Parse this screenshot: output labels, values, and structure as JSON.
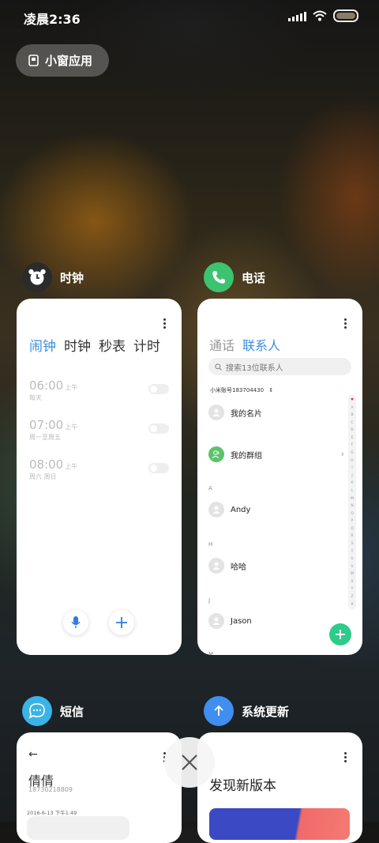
{
  "status_bar": {
    "time": "凌晨2:36"
  },
  "floating_window": {
    "label": "小窗应用"
  },
  "apps": {
    "clock": {
      "name": "时钟",
      "icon_color": "#2b2b2b",
      "tabs": [
        "闹钟",
        "时钟",
        "秒表",
        "计时"
      ],
      "alarms": [
        {
          "time": "06:00",
          "ampm": "上午",
          "repeat": "每天"
        },
        {
          "time": "07:00",
          "ampm": "上午",
          "repeat": "周一至周五"
        },
        {
          "time": "08:00",
          "ampm": "上午",
          "repeat": "周六 周日"
        }
      ]
    },
    "phone": {
      "name": "电话",
      "icon_color": "#3cc371",
      "tabs": [
        "通话",
        "联系人"
      ],
      "search_placeholder": "搜索13位联系人",
      "account": "小米账号183704430",
      "my_card": "我的名片",
      "my_group": "我的群组",
      "sections": [
        {
          "letter": "A",
          "name": "Andy"
        },
        {
          "letter": "H",
          "name": "哈哈"
        },
        {
          "letter": "J",
          "name": "Jason"
        }
      ],
      "next_section": "M",
      "index_letters": [
        "♥",
        "A",
        "B",
        "C",
        "D",
        "E",
        "F",
        "G",
        "H",
        "I",
        "J",
        "K",
        "L",
        "M",
        "N",
        "O",
        "P",
        "Q",
        "R",
        "S",
        "T",
        "U",
        "V",
        "W",
        "X",
        "Y",
        "Z",
        "#"
      ]
    },
    "sms": {
      "name": "短信",
      "icon_color": "#3ab4e6",
      "contact": "倩倩",
      "number": "18730218809",
      "timestamp": "2016-6-13 下午1:49"
    },
    "update": {
      "name": "系统更新",
      "icon_color": "#3f8ef0",
      "headline": "发现新版本"
    }
  }
}
